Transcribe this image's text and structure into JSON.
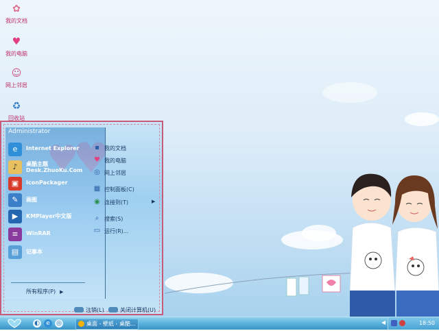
{
  "desktop": {
    "icons": [
      {
        "label": "我的文档",
        "icon": "documents-icon"
      },
      {
        "label": "我的电脑",
        "icon": "computer-icon"
      },
      {
        "label": "网上邻居",
        "icon": "network-icon"
      },
      {
        "label": "回收站",
        "icon": "recycle-bin-icon"
      }
    ]
  },
  "start_menu": {
    "user": "Administrator",
    "programs": [
      {
        "label": "Internet Explorer",
        "icon": "ie-icon",
        "color": "#2f8fd8"
      },
      {
        "label": "桌酷主题\nDesk.ZhuoKu.Com",
        "line1": "桌酷主题",
        "line2": "Desk.ZhuoKu.Com",
        "icon": "theme-icon",
        "color": "#e8c060"
      },
      {
        "label": "IconPackager",
        "icon": "iconpackager-icon",
        "color": "#d83a2a"
      },
      {
        "label": "画图",
        "icon": "paint-icon",
        "color": "#3a7fc8"
      },
      {
        "label": "KMPlayer中文版",
        "icon": "kmplayer-icon",
        "color": "#2466b0"
      },
      {
        "label": "WinRAR",
        "icon": "winrar-icon",
        "color": "#8a3a9c"
      },
      {
        "label": "记事本",
        "icon": "notepad-icon",
        "color": "#5aa0d8"
      }
    ],
    "all_programs": "所有程序(P)",
    "places": [
      {
        "label": "我的文档",
        "icon": "documents-icon"
      },
      {
        "label": "我的电脑",
        "icon": "computer-icon"
      },
      {
        "label": "网上邻居",
        "icon": "network-icon"
      },
      {
        "label": "控制面板(C)",
        "icon": "control-panel-icon"
      },
      {
        "label": "连接到(T)",
        "icon": "connect-icon"
      },
      {
        "label": "搜索(S)",
        "icon": "search-icon"
      },
      {
        "label": "运行(R)...",
        "icon": "run-icon"
      }
    ],
    "logoff": "注销(L)",
    "shutdown": "关闭计算机(U)"
  },
  "taskbar": {
    "task_label": "桌面 - 壁纸 - 桌酷...",
    "clock": "18:50"
  },
  "colors": {
    "taskbar": "#4aa3d5",
    "menu_border": "#c85a7a",
    "desktop_label": "#c0306a"
  }
}
